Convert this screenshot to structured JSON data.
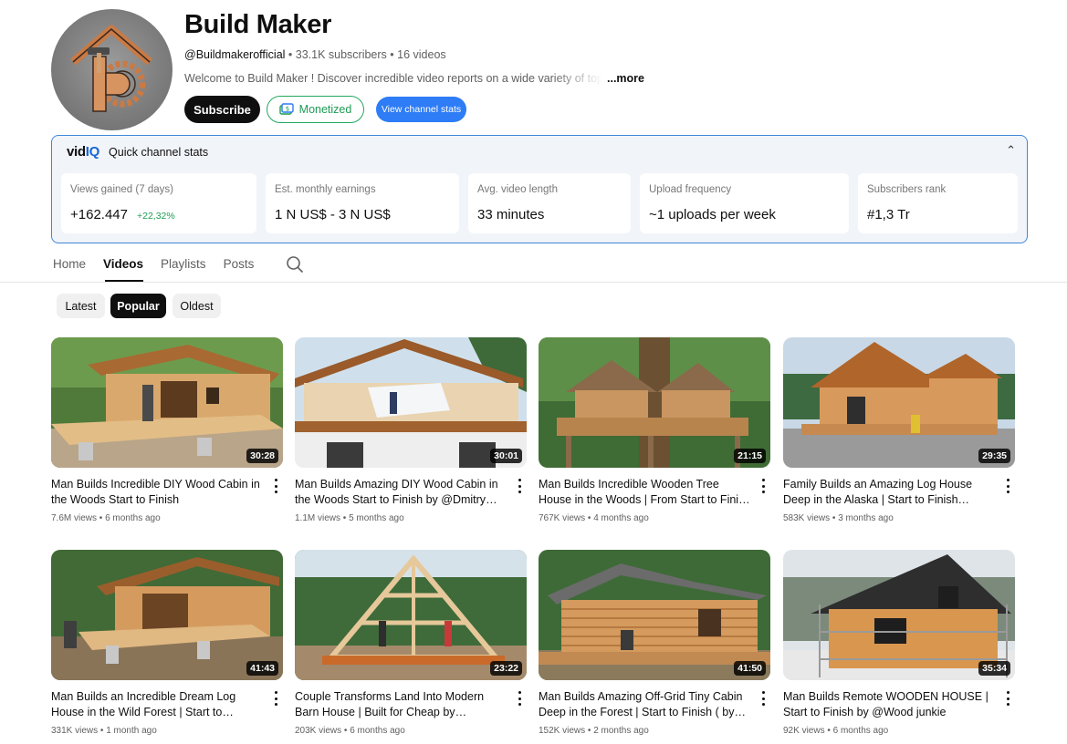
{
  "channel": {
    "name": "Build Maker",
    "handle": "@Buildmakerofficial",
    "subscribers": "33.1K subscribers",
    "videos_count": "16 videos",
    "separator": " • ",
    "description": "Welcome to Build Maker ! Discover incredible video reports on a wide variety of topics—fr",
    "more_label": "...more",
    "avatar_icon": "house-hammer-gear-logo"
  },
  "buttons": {
    "subscribe": "Subscribe",
    "monetized": "Monetized",
    "view_stats": "View channel stats"
  },
  "vidiq": {
    "logo_a": "vid",
    "logo_b": "IQ",
    "title": "Quick channel stats",
    "collapse_icon": "chevron-up-icon",
    "stats": [
      {
        "label": "Views gained (7 days)",
        "value": "+162.447",
        "delta": "+22,32%"
      },
      {
        "label": "Est. monthly earnings",
        "value": "1 N US$ - 3 N US$"
      },
      {
        "label": "Avg. video length",
        "value": "33 minutes"
      },
      {
        "label": "Upload frequency",
        "value": "~1 uploads per week"
      },
      {
        "label": "Subscribers rank",
        "value": "#1,3 Tr"
      }
    ]
  },
  "tabs": [
    "Home",
    "Videos",
    "Playlists",
    "Posts"
  ],
  "active_tab": "Videos",
  "chips": [
    "Latest",
    "Popular",
    "Oldest"
  ],
  "active_chip": "Popular",
  "videos": [
    {
      "title": "Man Builds Incredible DIY Wood Cabin in the Woods Start to Finish",
      "views": "7.6M views",
      "age": "6 months ago",
      "duration": "30:28"
    },
    {
      "title": "Man Builds Amazing DIY Wood Cabin in the Woods Start to Finish by @Dmitry Lukin",
      "views": "1.1M views",
      "age": "5 months ago",
      "duration": "30:01"
    },
    {
      "title": "Man Builds Incredible Wooden Tree House in the Woods | From Start to Finish by…",
      "views": "767K views",
      "age": "4 months ago",
      "duration": "21:15"
    },
    {
      "title": "Family Builds an Amazing Log House Deep in the Alaska | Start to Finish by@Montana…",
      "views": "583K views",
      "age": "3 months ago",
      "duration": "29:35"
    },
    {
      "title": "Man Builds an Incredible Dream Log House in the Wild Forest | Start to Finish@Life on…",
      "views": "331K views",
      "age": "1 month ago",
      "duration": "41:43"
    },
    {
      "title": "Couple Transforms Land Into Modern Barn House | Built for Cheap by @Borsch_TV",
      "views": "203K views",
      "age": "6 months ago",
      "duration": "23:22"
    },
    {
      "title": "Man Builds Amazing Off-Grid Tiny Cabin Deep in the Forest | Start to Finish ( by…",
      "views": "152K views",
      "age": "2 months ago",
      "duration": "41:50"
    },
    {
      "title": "Man Builds Remote WOODEN HOUSE | Start to Finish by @Wood junkie",
      "views": "92K views",
      "age": "6 months ago",
      "duration": "35:34"
    }
  ],
  "colors": {
    "accent_blue": "#2e7cf6",
    "monetized_green": "#1d9a55",
    "vidiq_border": "#3f88d8",
    "wood": "#c98a4b"
  }
}
